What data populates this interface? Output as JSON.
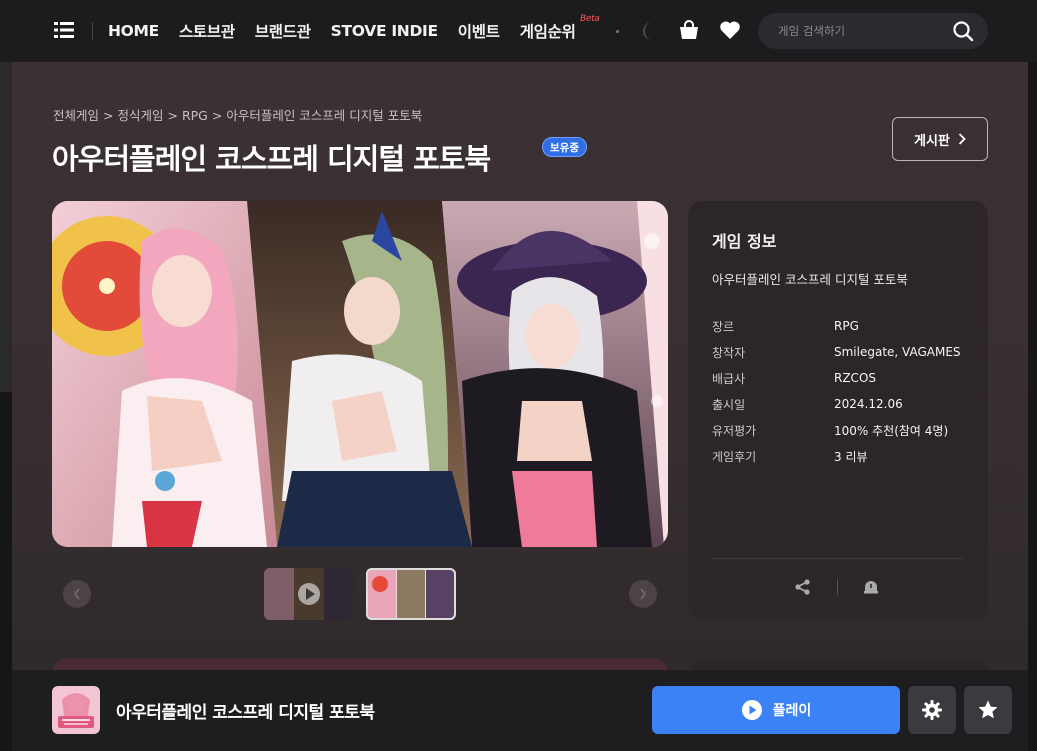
{
  "nav": {
    "items": [
      {
        "label": "HOME"
      },
      {
        "label": "스토브관"
      },
      {
        "label": "브랜드관"
      },
      {
        "label": "STOVE INDIE"
      },
      {
        "label": "이벤트"
      },
      {
        "label": "게임순위"
      }
    ],
    "beta_label": "Beta",
    "search_placeholder": "게임 검색하기"
  },
  "breadcrumb": [
    "전체게임",
    "정식게임",
    "RPG",
    "아우터플레인 코스프레 디지털 포토북"
  ],
  "breadcrumb_separator": ">",
  "title": "아우터플레인 코스프레 디지털 포토북",
  "owned_badge": "보유중",
  "board_button": "게시판",
  "info": {
    "heading": "게임 정보",
    "name": "아우터플레인 코스프레 디지털 포토북",
    "rows": [
      {
        "key": "장르",
        "value": "RPG"
      },
      {
        "key": "창작자",
        "value": "Smilegate, VAGAMES"
      },
      {
        "key": "배급사",
        "value": "RZCOS"
      },
      {
        "key": "출시일",
        "value": "2024.12.06"
      },
      {
        "key": "유저평가",
        "value": "100% 추천(참여 4명)"
      },
      {
        "key": "게임후기",
        "value": "3 리뷰"
      }
    ]
  },
  "playbar": {
    "title": "아우터플레인 코스프레 디지털 포토북",
    "play_label": "플레이"
  },
  "colors": {
    "accent": "#3b82f6",
    "badge": "#2f6ee3",
    "beta": "#ff5a5a"
  }
}
